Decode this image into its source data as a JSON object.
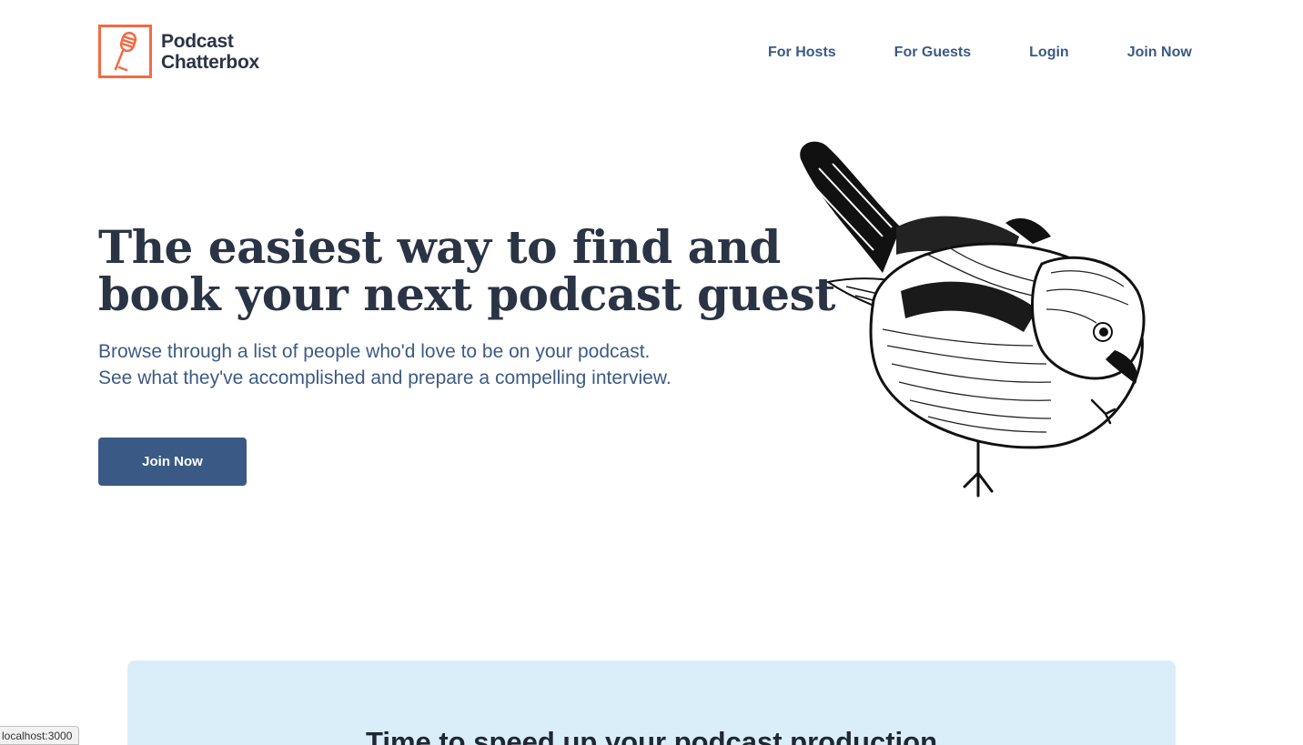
{
  "logo": {
    "icon": "microphone-icon",
    "line1": "Podcast",
    "line2": "Chatterbox",
    "color": "#f26b43"
  },
  "nav": {
    "items": [
      {
        "label": "For Hosts"
      },
      {
        "label": "For Guests"
      },
      {
        "label": "Login"
      },
      {
        "label": "Join Now"
      }
    ]
  },
  "hero": {
    "title_line1": "The easiest way to find and",
    "title_line2": "book your next podcast guest",
    "sub_line1": "Browse through a list of people who'd love to be on your podcast.",
    "sub_line2": "See what they've accomplished and prepare a compelling interview.",
    "cta_label": "Join Now",
    "illustration": "sparrow-illustration"
  },
  "feature": {
    "title": "Time to speed up your podcast production"
  },
  "status_bar": {
    "url": "localhost:3000"
  },
  "colors": {
    "brand": "#f26b43",
    "primary": "#3a5a85",
    "heading": "#2b3445",
    "feature_bg": "#d9eef9"
  }
}
